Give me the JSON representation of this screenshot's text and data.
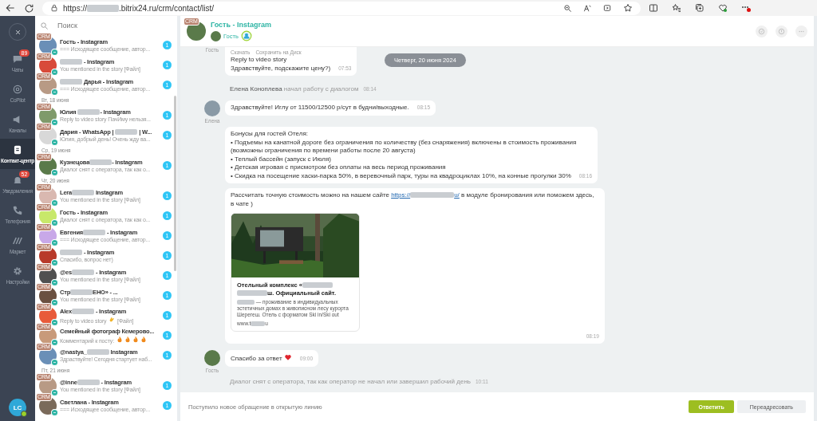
{
  "browser": {
    "url": [
      "https://",
      {
        "kind": "blur"
      },
      ".bitrix24.ru/crm/contact/list/"
    ]
  },
  "nav": {
    "items": [
      {
        "kind": "chat",
        "label": "Чаты",
        "badge": "89",
        "selected": false
      },
      {
        "kind": "copilot",
        "label": "CoPilot",
        "selected": false
      },
      {
        "kind": "channels",
        "label": "Каналы",
        "selected": false
      },
      {
        "kind": "contact",
        "label": "Контакт-центр",
        "selected": true
      },
      {
        "kind": "bell",
        "label": "Уведомления",
        "badge": "52",
        "selected": false
      },
      {
        "kind": "phone",
        "label": "Телефония",
        "selected": false
      },
      {
        "kind": "market",
        "label": "Маркет",
        "selected": false
      },
      {
        "kind": "gear",
        "label": "Настройки",
        "selected": false
      }
    ],
    "user": {
      "initials": "LC",
      "online": true
    }
  },
  "chat_list": {
    "search": {
      "placeholder": "Поиск"
    },
    "items": [
      {
        "kind": "chat",
        "badge": "CRM",
        "name": [
          "Гость - Instagram"
        ],
        "preview": [
          "=== Исходящее сообщение, автор..."
        ],
        "count": "1"
      },
      {
        "kind": "chat",
        "badge": "CRM",
        "name": [
          {
            "kind": "blur"
          },
          " - Instagram"
        ],
        "preview": [
          "You mentioned in the story [Файл]"
        ],
        "count": "1"
      },
      {
        "kind": "chat",
        "badge": "CRM",
        "name": [
          {
            "kind": "blur"
          },
          " Дарья - Instagram"
        ],
        "preview": [
          "=== Исходящее сообщение, автор..."
        ],
        "count": "1"
      },
      {
        "kind": "date",
        "label": "Вт, 18 июня"
      },
      {
        "kind": "chat",
        "badge": "CRM",
        "name": [
          "Юлия ",
          {
            "kind": "blur"
          },
          "- Instagram"
        ],
        "preview": [
          "Reply to video story ПачИму нельзя..."
        ],
        "count": "1"
      },
      {
        "kind": "chat",
        "badge": "CRM",
        "name": [
          "Дария - WhatsApp | ",
          {
            "kind": "blur"
          },
          " | W..."
        ],
        "preview": [
          "Юлия, добрый день! Очень жду ва..."
        ],
        "count": "1"
      },
      {
        "kind": "date",
        "label": "Ср, 19 июня"
      },
      {
        "kind": "chat",
        "badge": "CRM",
        "name": [
          "Кузнецова",
          {
            "kind": "blur"
          },
          "- Instagram"
        ],
        "preview": [
          "Диалог снят с оператора, так как о..."
        ],
        "count": "1"
      },
      {
        "kind": "date",
        "label": "Чт, 20 июня"
      },
      {
        "kind": "chat",
        "badge": "CRM",
        "name": [
          "Lera",
          {
            "kind": "blur"
          },
          " Instagram"
        ],
        "preview": [
          "You mentioned in the story [Файл]"
        ],
        "count": "1"
      },
      {
        "kind": "chat",
        "badge": "CRM",
        "name": [
          "Гость - Instagram"
        ],
        "preview": [
          "Диалог снят с оператора, так как о..."
        ],
        "count": "1"
      },
      {
        "kind": "chat",
        "badge": "CRM",
        "name": [
          "Евгения",
          {
            "kind": "blur"
          },
          " - Instagram"
        ],
        "preview": [
          "=== Исходящее сообщение, автор..."
        ],
        "count": "1"
      },
      {
        "kind": "chat",
        "badge": "CRM",
        "name": [
          {
            "kind": "blur"
          },
          " - Instagram"
        ],
        "preview": [
          "Спасибо, вопрос нет)"
        ],
        "count": "1"
      },
      {
        "kind": "chat",
        "badge": "CRM",
        "name": [
          "@es",
          {
            "kind": "blur"
          },
          " - Instagram"
        ],
        "preview": [
          "You mentioned in the story [Файл]"
        ],
        "count": "1"
      },
      {
        "kind": "chat",
        "badge": "CRM",
        "name": [
          "Стр",
          {
            "kind": "blur"
          },
          "ЕНО» - ..."
        ],
        "preview": [
          "You mentioned in the story [Файл]"
        ],
        "count": "1"
      },
      {
        "kind": "chat",
        "badge": "CRM",
        "name": [
          "Alex",
          {
            "kind": "blur"
          },
          " - Instagram"
        ],
        "preview": [
          "Reply to video story ",
          {
            "kind": "clap"
          },
          " [Файл]"
        ],
        "count": "1"
      },
      {
        "kind": "chat",
        "badge": "CRM",
        "name": [
          "Семейный фотограф Кемерово..."
        ],
        "preview": [
          "Комментарий к посту: ",
          {
            "kind": "fire"
          },
          {
            "kind": "fire"
          },
          {
            "kind": "fire"
          },
          {
            "kind": "fire"
          }
        ],
        "count": "1"
      },
      {
        "kind": "chat",
        "badge": "CRM",
        "name": [
          "@nastya_",
          {
            "kind": "blur"
          },
          " Instagram"
        ],
        "preview": [
          "Здраствуйте! Сегодня стартует наб..."
        ],
        "count": "1"
      },
      {
        "kind": "date",
        "label": "Пт, 21 июня"
      },
      {
        "kind": "chat",
        "badge": "CRM",
        "name": [
          "@inne",
          {
            "kind": "blur"
          },
          " - Instagram"
        ],
        "preview": [
          "You mentioned in the story [Файл]"
        ],
        "count": "1"
      },
      {
        "kind": "chat",
        "badge": "CRM",
        "name": [
          "Светлана - Instagram"
        ],
        "preview": [
          "=== Исходящее сообщение, автор..."
        ],
        "count": "1"
      }
    ]
  },
  "chat": {
    "header": {
      "badge": "CRM",
      "title": "Гость - Instagram",
      "member": "Гость"
    },
    "date_pill": "Четверг, 20 июня 2024",
    "messages": [
      {
        "kind": "message",
        "author": "Гость",
        "cut": true,
        "actions": [
          "Скачать",
          "Сохранить на Диск"
        ],
        "lines": [
          [
            "Reply to video story"
          ],
          [
            "Здравствуйте, подскажите цену?)"
          ]
        ],
        "time": "07:53"
      },
      {
        "kind": "system",
        "name": "Елена Коноплева",
        "text": "начал работу с диалогом",
        "time": "08:14"
      },
      {
        "kind": "message",
        "author": "Елена",
        "lines": [
          [
            "Здравствуйте! Иглу от 11500/12500 р/сут в будни/выходные."
          ]
        ],
        "time": "08:15"
      },
      {
        "kind": "message",
        "lines": [
          [
            "Бонусы для гостей Отеля:"
          ],
          [
            "• Подъемы на канатной дороге без ограничения по количеству (без снаряжения) включены в стоимость проживания"
          ],
          [
            "(возможны ограничения по времени работы после 20 августа)"
          ],
          [
            "• Теплый бассейн (запуск с Июля)"
          ],
          [
            "• Детская игровая с присмотром без оплаты на весь период проживания"
          ],
          [
            "• Скидка на посещение хаски-парка 50%, в веревочный парк, туры на квадроциклах 10%, на конные прогулки 30%"
          ]
        ],
        "time": "08:16"
      },
      {
        "kind": "message",
        "lines": [
          [
            "Рассчитать точную стоимость можно на нашем сайте ",
            {
              "kind": "link",
              "parts": [
                "https://",
                {
                  "kind": "blur"
                },
                "u/"
              ]
            },
            " в модуле бронирования или поможем здесь,"
          ],
          [
            "в чате )"
          ]
        ],
        "card": {
          "kind": "picture",
          "title": [
            "Отельный комплекс «",
            {
              "kind": "blur"
            },
            {
              "kind": "blur"
            },
            "ш. Официальный сайт."
          ],
          "description": [
            {
              "kind": "blur"
            },
            " — проживание в индивидуальных эстетичных домах в живописном лесу курорта Шерегеш. Отель с форматом Ski in/Ski out"
          ],
          "site": [
            "www.t",
            {
              "kind": "blur"
            },
            "u"
          ]
        },
        "time": "08:19"
      },
      {
        "kind": "message",
        "author": "Гость",
        "lines": [
          [
            "Спасибо за ответ ",
            {
              "kind": "heart"
            }
          ]
        ],
        "time": "09:00"
      },
      {
        "kind": "system",
        "text": "Диалог снят с оператора, так как оператор не начал или завершил рабочий день",
        "time": "10:11"
      }
    ],
    "footer": {
      "notice": "Поступило новое обращение в открытую линию",
      "buttons": [
        {
          "kind": "primary",
          "label": "Ответить"
        },
        {
          "kind": "secondary",
          "label": "Переадресовать"
        }
      ]
    }
  }
}
